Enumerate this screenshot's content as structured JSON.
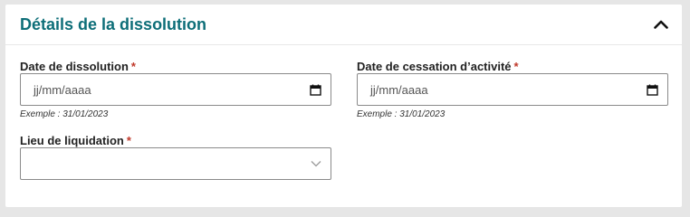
{
  "section": {
    "title": "Détails de la dissolution"
  },
  "fields": {
    "dissolution_date": {
      "label": "Date de dissolution",
      "required_mark": "*",
      "placeholder": "jj/mm/aaaa",
      "hint": "Exemple : 31/01/2023"
    },
    "cessation_date": {
      "label": "Date de cessation d’activité",
      "required_mark": "*",
      "placeholder": "jj/mm/aaaa",
      "hint": "Exemple : 31/01/2023"
    },
    "liquidation_place": {
      "label": "Lieu de liquidation",
      "required_mark": "*",
      "value": ""
    }
  },
  "icons": {
    "collapse": "chevron-up-icon",
    "calendar": "calendar-icon",
    "dropdown": "chevron-down-icon"
  },
  "colors": {
    "title": "#0d6e78",
    "required": "#c0392b",
    "border": "#8a8a8a"
  }
}
